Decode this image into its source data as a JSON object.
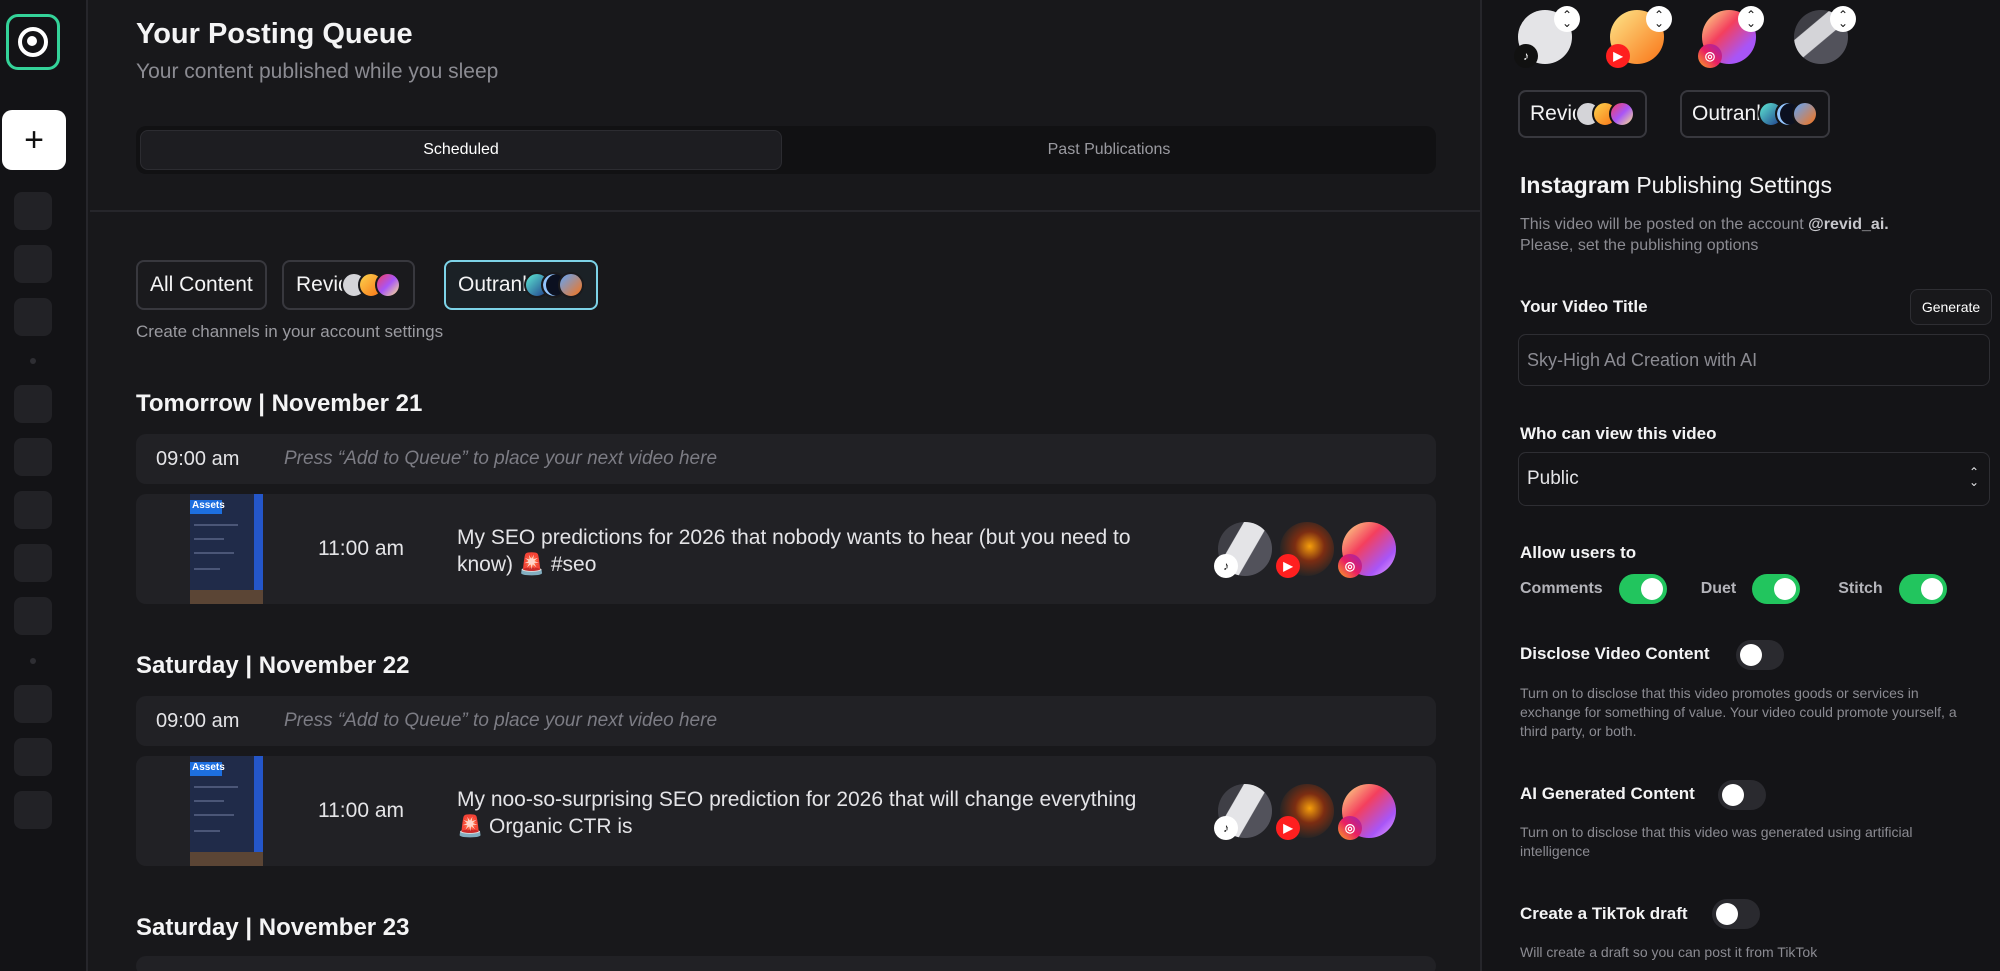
{
  "header": {
    "title": "Your Posting Queue",
    "subtitle": "Your content published while you sleep"
  },
  "rail": {
    "add_label": "+"
  },
  "tabs": [
    {
      "label": "Scheduled",
      "active": true
    },
    {
      "label": "Past Publications",
      "active": false
    }
  ],
  "filters": [
    {
      "label": "All Content"
    },
    {
      "label": "Revid"
    },
    {
      "label": "Outrank",
      "selected": true
    }
  ],
  "filters_hint": "Create channels in your account settings",
  "days": [
    {
      "heading": "Tomorrow | November 21",
      "empty_slot": {
        "time": "09:00 am",
        "placeholder": "Press “Add to Queue” to place your next video here"
      },
      "post": {
        "time": "11:00 am",
        "caption": "My SEO predictions for 2026 that nobody wants to hear (but you need to know) 🚨 #seo",
        "thumb_label": "Assets"
      }
    },
    {
      "heading": "Saturday | November 22",
      "empty_slot": {
        "time": "09:00 am",
        "placeholder": "Press “Add to Queue” to place your next video here"
      },
      "post": {
        "time": "11:00 am",
        "caption": "My noo-so-surprising SEO prediction for 2026 that will change everything 🚨 Organic CTR is",
        "thumb_label": "Assets"
      }
    },
    {
      "heading": "Saturday | November 23"
    }
  ],
  "platform_badges": {
    "tiktok": "♪",
    "youtube": "▶",
    "instagram": "◎"
  },
  "panel": {
    "chips": [
      {
        "label": "Revid"
      },
      {
        "label": "Outrank"
      }
    ],
    "title_bold": "Instagram",
    "title_rest": " Publishing Settings",
    "desc_prefix": "This video will be posted on the account ",
    "account": "@revid_ai.",
    "desc_suffix": "Please, set the publishing options",
    "video_title_label": "Your Video Title",
    "generate_label": "Generate",
    "video_title_value": "Sky-High Ad Creation with AI",
    "who_can_view_label": "Who can view this video",
    "who_can_view_value": "Public",
    "allow_label": "Allow users to",
    "allow_items": [
      {
        "label": "Comments",
        "on": true
      },
      {
        "label": "Duet",
        "on": true
      },
      {
        "label": "Stitch",
        "on": true
      }
    ],
    "disclose_label": "Disclose Video Content",
    "disclose_on": false,
    "disclose_desc": "Turn on to disclose that this video promotes goods or services in exchange for something of value. Your video could promote yourself, a third party, or both.",
    "ai_label": "AI Generated Content",
    "ai_on": false,
    "ai_desc": "Turn on to disclose that this video was generated using artificial intelligence",
    "draft_label": "Create a TikTok draft",
    "draft_on": false,
    "draft_desc": "Will create a draft so you can post it from TikTok"
  },
  "colors": {
    "accent_green": "#22c55e",
    "selected_border": "#7dd3e8",
    "logo_green": "#34d399"
  }
}
